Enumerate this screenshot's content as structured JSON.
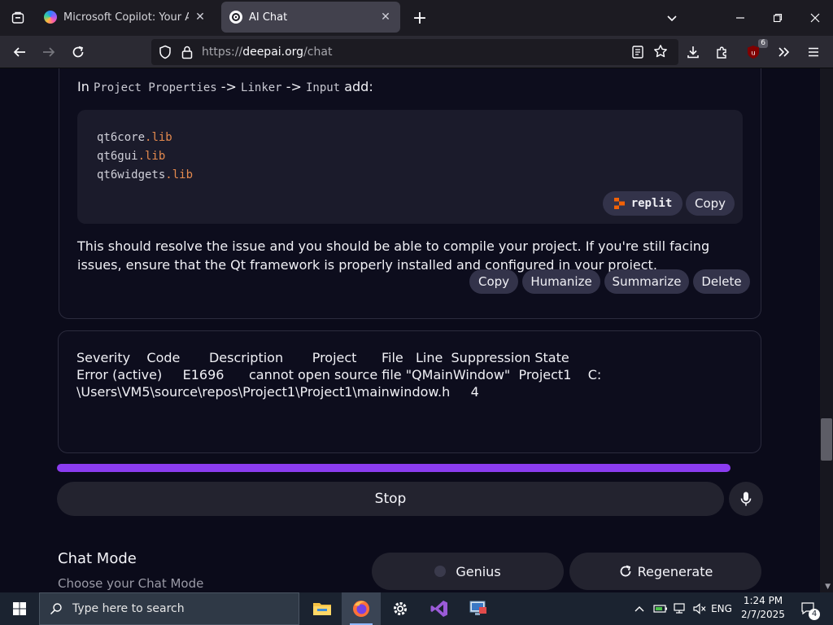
{
  "browser": {
    "tabs": [
      {
        "title": "Microsoft Copilot: Your AI companion",
        "active": false
      },
      {
        "title": "AI Chat",
        "active": true
      }
    ],
    "url": {
      "scheme": "https://",
      "host": "deepai.org",
      "path": "/chat"
    },
    "extension_badge": "6"
  },
  "chat": {
    "assistant_message": {
      "intro_prefix": "In ",
      "path_part1": "Project Properties",
      "arrow1": " -> ",
      "path_part2": "Linker",
      "arrow2": " -> ",
      "path_part3": "Input",
      "intro_suffix": " add:",
      "code_lines": [
        {
          "name": "qt6core",
          "ext": ".lib"
        },
        {
          "name": "qt6gui",
          "ext": ".lib"
        },
        {
          "name": "qt6widgets",
          "ext": ".lib"
        }
      ],
      "code_replit_label": "replit",
      "code_copy_label": "Copy",
      "paragraph": "This should resolve the issue and you should be able to compile your project. If you're still facing issues, ensure that the Qt framework is properly installed and configured in your project.",
      "actions": {
        "copy": "Copy",
        "humanize": "Humanize",
        "summarize": "Summarize",
        "delete": "Delete"
      }
    },
    "user_input_text": "Severity    Code       Description       Project      File   Line  Suppression State\nError (active)     E1696      cannot open source file \"QMainWindow\"  Project1    C:\n\\Users\\VM5\\source\\repos\\Project1\\Project1\\mainwindow.h     4",
    "progress_fraction": 1.0,
    "stop_label": "Stop",
    "chat_mode": {
      "title": "Chat Mode",
      "subtitle": "Choose your Chat Mode",
      "genius_label": "Genius",
      "regenerate_label": "Regenerate"
    }
  },
  "taskbar": {
    "search_placeholder": "Type here to search",
    "language": "ENG",
    "time": "1:24 PM",
    "date": "2/7/2025",
    "notification_count": "4"
  },
  "colors": {
    "page_bg": "#0b0b1a",
    "progress": "#8b3cf0",
    "code_ext": "#e58a4e",
    "replit_orange": "#f26207"
  }
}
